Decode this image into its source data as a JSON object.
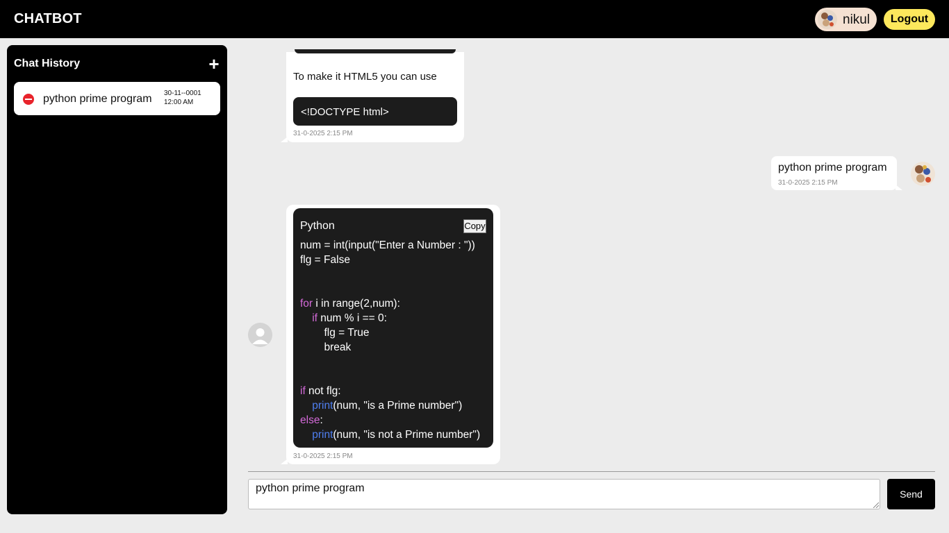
{
  "header": {
    "brand": "CHATBOT",
    "username": "nikul",
    "logout_label": "Logout"
  },
  "sidebar": {
    "title": "Chat History",
    "new_chat_symbol": "+",
    "items": [
      {
        "label": "python prime program",
        "date": "30-11--0001",
        "time": "12:00 AM"
      }
    ]
  },
  "messages": {
    "first_bot": {
      "text": "To make it HTML5 you can use",
      "code": "<!DOCTYPE html>",
      "timestamp": "31-0-2025 2:15 PM"
    },
    "user": {
      "text": "python prime program",
      "timestamp": "31-0-2025 2:15 PM"
    },
    "second_bot": {
      "language": "Python",
      "copy_label": "Copy",
      "timestamp": "31-0-2025 2:15 PM",
      "code_lines": [
        "num = int(input(\"Enter a Number : \"))",
        "flg = False",
        "",
        "",
        "for i in range(2,num):",
        "    if num % i == 0:",
        "        flg = True",
        "        break",
        "",
        "",
        "if not flg:",
        "    print(num, \"is a Prime number\")",
        "else:",
        "    print(num, \"is not a Prime number\")"
      ]
    }
  },
  "composer": {
    "value": "python prime program",
    "send_label": "Send"
  },
  "colors": {
    "accent_yellow": "#fde85c",
    "delete_red": "#e8232b",
    "keyword": "#d46ad9",
    "builtin": "#4f7ff0"
  }
}
